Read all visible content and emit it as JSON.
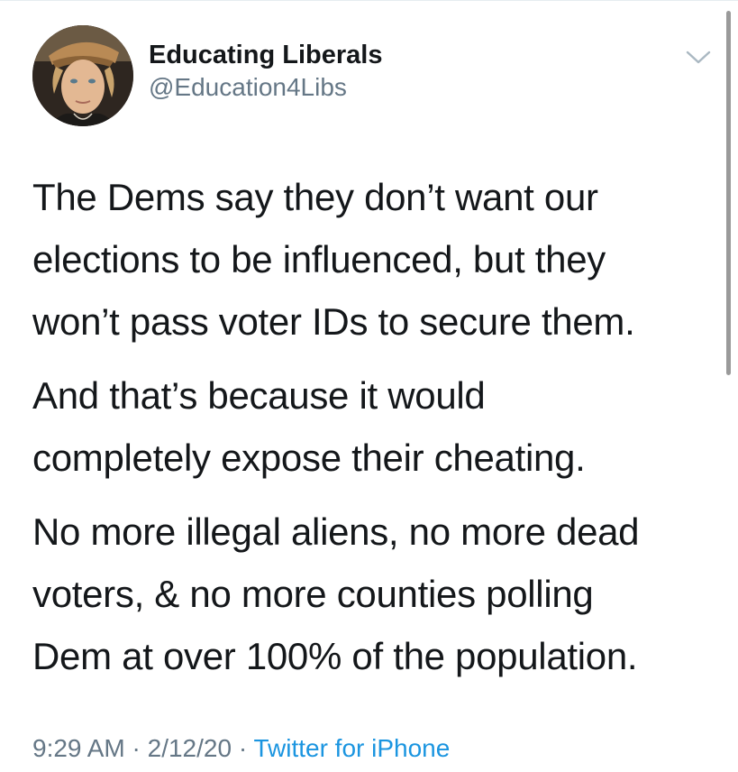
{
  "author": {
    "display_name": "Educating Liberals",
    "handle": "@Education4Libs"
  },
  "icons": {
    "avatar": "profile-photo-icon",
    "caret": "chevron-down-icon"
  },
  "tweet": {
    "paragraphs": [
      {
        "lines": [
          "The Dems say they don’t want our",
          "elections to be influenced, but they",
          "won’t pass voter IDs to secure them."
        ]
      },
      {
        "lines": [
          "And that’s because it would",
          "completely expose their cheating."
        ]
      },
      {
        "lines": [
          "No more illegal aliens, no more dead",
          "voters, & no more counties polling",
          "Dem at over 100% of the population."
        ]
      }
    ]
  },
  "meta": {
    "time": "9:29 AM",
    "separator": "·",
    "date": "2/12/20",
    "source": "Twitter for iPhone"
  },
  "colors": {
    "text": "#14171a",
    "secondary": "#657786",
    "link": "#1b95e0"
  }
}
